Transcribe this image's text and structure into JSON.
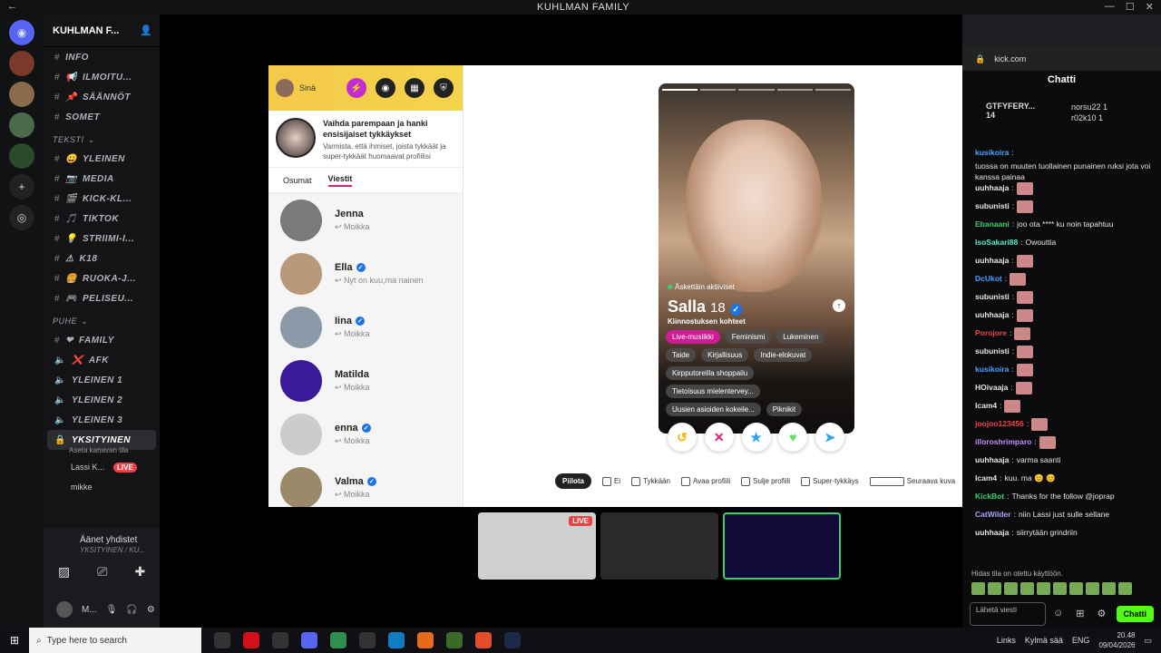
{
  "window": {
    "title": "KUHLMAN FAMILY"
  },
  "discord": {
    "server_name": "KUHLMAN F...",
    "channels": [
      {
        "type": "text",
        "name": "INFO",
        "collapsed": true
      },
      {
        "type": "text",
        "name": "ILMOITU...",
        "emoji": "📢"
      },
      {
        "type": "text",
        "name": "SÄÄNNÖT",
        "emoji": "📌"
      },
      {
        "type": "text",
        "name": "SOMET",
        "emoji": ""
      },
      {
        "type": "category",
        "name": "TEKSTI"
      },
      {
        "type": "text",
        "name": "YLEINEN",
        "emoji": "😀"
      },
      {
        "type": "text",
        "name": "MEDIA",
        "emoji": "📷"
      },
      {
        "type": "text",
        "name": "KICK-KL...",
        "emoji": "🎬"
      },
      {
        "type": "text",
        "name": "TIKTOK",
        "emoji": "🎵"
      },
      {
        "type": "text",
        "name": "STRIIMI-I...",
        "emoji": "💡"
      },
      {
        "type": "text",
        "name": "K18",
        "emoji": "⚠"
      },
      {
        "type": "text",
        "name": "RUOKA-J...",
        "emoji": "🍔"
      },
      {
        "type": "text",
        "name": "PELISEU...",
        "emoji": "🎮"
      },
      {
        "type": "category",
        "name": "PUHE"
      },
      {
        "type": "voice",
        "name": "FAMILY",
        "emoji": "❤"
      },
      {
        "type": "voice",
        "name": "AFK",
        "emoji": "❌"
      },
      {
        "type": "voice",
        "name": "YLEINEN 1"
      },
      {
        "type": "voice",
        "name": "YLEINEN 2"
      },
      {
        "type": "voice",
        "name": "YLEINEN 3"
      }
    ],
    "active_channel": "YKSITYINEN",
    "active_channel_sub": "Aseta kanavan tila",
    "voice_users": [
      {
        "name": "Lassi K...",
        "live": "LIVE"
      },
      {
        "name": "mikke"
      }
    ],
    "voice_status": "Äänet yhdistet",
    "voice_channel": "YKSITYINEN / KU...",
    "self_name": "M..."
  },
  "tinder": {
    "self_label": "Sinä",
    "promo_title": "Vaihda parempaan ja hanki ensisijaiset tykkäykset",
    "promo_desc": "Varmista, että ihmiset, joista tykkäät ja super-tykkäät huomaavat profiilisi",
    "tabs": [
      "Osumat",
      "Viestit"
    ],
    "messages": [
      {
        "name": "Jenna",
        "verified": false,
        "preview": "Moikka"
      },
      {
        "name": "Ella",
        "verified": true,
        "preview": "Nyt on kuu,ma nainen"
      },
      {
        "name": "Iina",
        "verified": true,
        "preview": "Moikka"
      },
      {
        "name": "Matilda",
        "verified": false,
        "preview": "Moikka"
      },
      {
        "name": "enna",
        "verified": true,
        "preview": "Moikka"
      },
      {
        "name": "Valma",
        "verified": true,
        "preview": "Moikka"
      }
    ],
    "profile": {
      "status": "Äskettäin aktiiviset",
      "name": "Salla",
      "age": "18",
      "interests_title": "Kiinnostuksen kohteet",
      "interests": [
        "Live-musiikki",
        "Feminismi",
        "Lukeminen",
        "Taide",
        "Kirjallisuus",
        "Indie-elokuvat",
        "Kirpputoreilla shoppailu",
        "Tietoisuus mielentervey...",
        "Uusien asioiden kokeile...",
        "Piknikit"
      ],
      "selected_interest": "Live-musiikki"
    },
    "shortcuts": {
      "hide": "Piilota",
      "no": "Ei",
      "like": "Tykkään",
      "open": "Avaa profiili",
      "close": "Sulje profiili",
      "super": "Super-tykkäys",
      "next": "Seuraava kuva"
    }
  },
  "thumbnails": {
    "live_label": "LIVE"
  },
  "kick": {
    "url": "kick.com",
    "chat_title": "Chatti",
    "top_gifter": "GTFYFERY...",
    "top_gifter_count": "14",
    "gifters": [
      {
        "name": "norsu22",
        "count": "1"
      },
      {
        "name": "r02k10",
        "count": "1"
      }
    ],
    "messages": [
      {
        "user": "kusikoira",
        "color": "#4aa3ff",
        "text": "tuossa on muuten tuollainen punainen ruksi jota voi kanssa painaa"
      },
      {
        "user": "uuhhaaja",
        "color": "#e6e6e6",
        "text": "",
        "emote": true
      },
      {
        "user": "subunisti",
        "color": "#e6e6e6",
        "text": "",
        "emote": true
      },
      {
        "user": "Ebanaani",
        "color": "#3ccf6e",
        "text": "joo ota **** ku noin tapahtuu"
      },
      {
        "user": "IsoSakari88",
        "color": "#5ee8c8",
        "text": "Owouttia"
      },
      {
        "user": "uuhhaaja",
        "color": "#e6e6e6",
        "text": "",
        "emote": true
      },
      {
        "user": "DcUkot",
        "color": "#4aa3ff",
        "text": "",
        "emote": true
      },
      {
        "user": "subunisti",
        "color": "#e6e6e6",
        "text": "",
        "emote": true
      },
      {
        "user": "uuhhaaja",
        "color": "#e6e6e6",
        "text": "",
        "emote": true
      },
      {
        "user": "Porojore",
        "color": "#e94646",
        "text": "",
        "emote": true
      },
      {
        "user": "subunisti",
        "color": "#e6e6e6",
        "text": "",
        "emote": true
      },
      {
        "user": "kusikoira",
        "color": "#4aa3ff",
        "text": "",
        "emote": true
      },
      {
        "user": "HOivaaja",
        "color": "#e6e6e6",
        "text": "",
        "emote": true
      },
      {
        "user": "Icam4",
        "color": "#e6e6e6",
        "text": "",
        "emote": true
      },
      {
        "user": "joojoo123456",
        "color": "#e94646",
        "text": "",
        "emote": true
      },
      {
        "user": "illoroshrimparo",
        "color": "#c58cff",
        "text": "",
        "emote": true
      },
      {
        "user": "uuhhaaja",
        "color": "#e6e6e6",
        "text": "varma saanti"
      },
      {
        "user": "Icam4",
        "color": "#e6e6e6",
        "text": "kuu. ma 😊 😊"
      },
      {
        "user": "KickBot",
        "color": "#3ccf6e",
        "text": "Thanks for the follow @joprap"
      },
      {
        "user": "CatWilder",
        "color": "#a6a6ff",
        "text": "niin Lassi just sulle sellane"
      },
      {
        "user": "uuhhaaja",
        "color": "#e6e6e6",
        "text": "siirrytään grindriin"
      }
    ],
    "used_hint": "Hidas tila on otettu käyttöön.",
    "input_placeholder": "Lähetä viesti",
    "send_label": "Chatti"
  },
  "taskbar": {
    "search_placeholder": "Type here to search",
    "links": "Links",
    "weather": "Kylmä sää",
    "lang": "ENG",
    "time": "20.48",
    "date": "09/04/2026"
  }
}
